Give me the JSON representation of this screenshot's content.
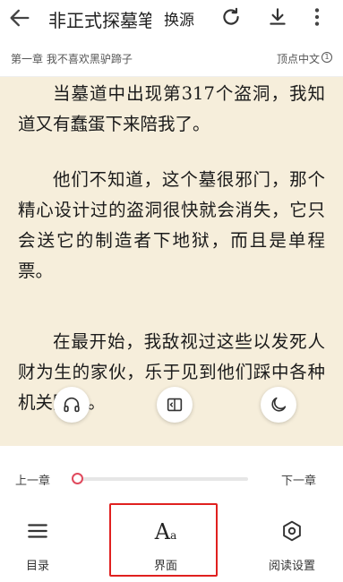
{
  "topbar": {
    "title": "非正式探墓笔记",
    "swap_label": "换源",
    "icons": [
      "back-arrow-icon",
      "refresh-icon",
      "download-icon",
      "more-vertical-icon"
    ]
  },
  "chapter": {
    "name": "第一章 我不喜欢黑驴蹄子",
    "source": "顶点中文",
    "source_index": "1"
  },
  "content": {
    "paragraphs": [
      "当墓道中出现第317个盗洞，我知道又有蠢蛋下来陪我了。",
      "他们不知道，这个墓很邪门，那个精心设计过的盗洞很快就会消失，它只会送它的制造者下地狱，而且是单程票。",
      "在最开始，我敌视过这些以发死人财为生的家伙，乐于见到他们踩中各种机关陷阱。"
    ]
  },
  "floating": {
    "icons": [
      "headphones-icon",
      "auto-page-icon",
      "night-mode-icon"
    ]
  },
  "progress": {
    "prev_label": "上一章",
    "next_label": "下一章",
    "value": 0,
    "accent": "#e04a5d"
  },
  "bottom_nav": {
    "toc_label": "目录",
    "ui_label": "界面",
    "ui_icon_text": "A",
    "ui_icon_small": "a",
    "settings_label": "阅读设置"
  },
  "colors": {
    "page_bg": "#f6eedb",
    "highlight": "#e0201f"
  }
}
